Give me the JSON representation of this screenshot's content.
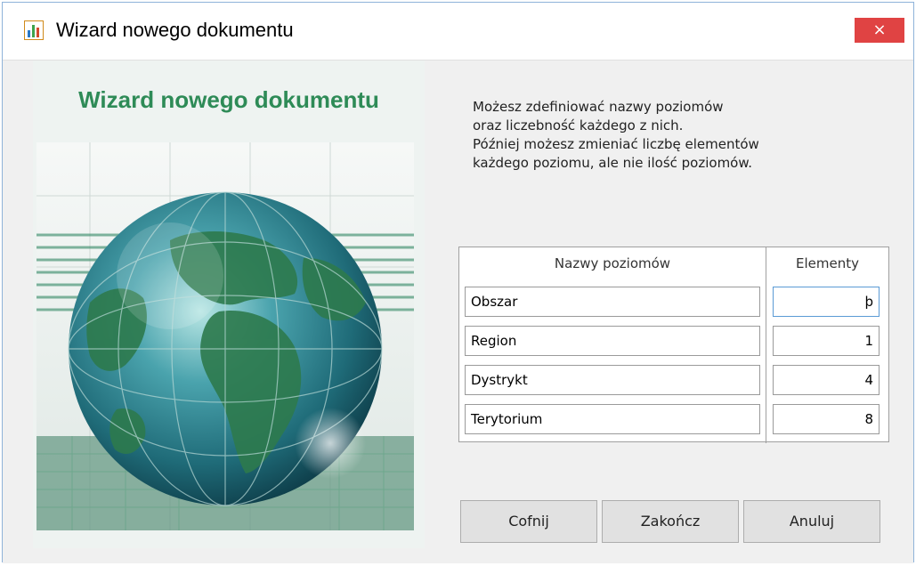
{
  "window": {
    "title": "Wizard nowego dokumentu",
    "close_label": "×",
    "app_icon": "bar-chart-icon"
  },
  "left_panel": {
    "heading": "Wizard nowego dokumentu",
    "image": "globe-image"
  },
  "description": {
    "lines": [
      "Możesz zdefiniować nazwy poziomów",
      "oraz liczebność każdego z nich.",
      "Później możesz zmieniać liczbę elementów",
      "każdego poziomu, ale nie ilość poziomów."
    ]
  },
  "levels_table": {
    "header_names": "Nazwy poziomów",
    "header_elements": "Elementy",
    "rows": [
      {
        "name": "Obszar",
        "elements": "þ"
      },
      {
        "name": "Region",
        "elements": "1"
      },
      {
        "name": "Dystrykt",
        "elements": "4"
      },
      {
        "name": "Terytorium",
        "elements": "8"
      }
    ]
  },
  "buttons": {
    "back": "Cofnij",
    "finish": "Zakończ",
    "cancel": "Anuluj"
  },
  "colors": {
    "heading_green": "#2e8b57",
    "close_red": "#e04343",
    "focus_blue": "#5b9bd5"
  }
}
